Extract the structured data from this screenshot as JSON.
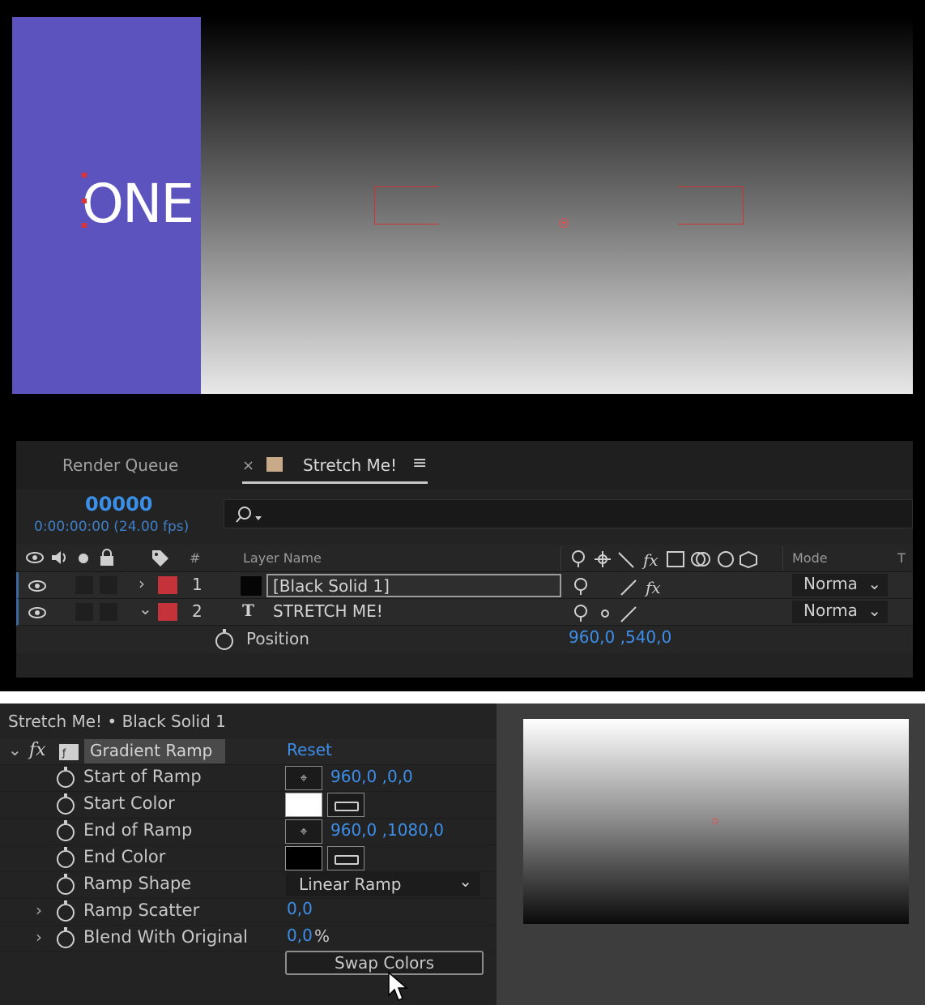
{
  "viewer": {
    "brand_text": "ONE",
    "accent_color": "#5c53bf",
    "gradient": [
      "#000000",
      "#e8e8e8"
    ]
  },
  "timeline": {
    "tabs": [
      {
        "label": "Render Queue",
        "active": false
      },
      {
        "label": "Stretch Me!",
        "active": true
      }
    ],
    "close_glyph": "×",
    "menu_glyph": "≡",
    "timecode": "00000",
    "timecode_sub": "0:00:00:00 (24.00 fps)",
    "search_icon": "search-icon",
    "columns": {
      "hash": "#",
      "layer_name": "Layer Name",
      "mode": "Mode",
      "t": "T"
    },
    "layers": [
      {
        "num": "1",
        "type_glyph": "",
        "name": "[Black Solid 1]",
        "mode": "Norma",
        "expanded": false,
        "label_color": "#c4323a"
      },
      {
        "num": "2",
        "type_glyph": "T",
        "name": "STRETCH ME!",
        "mode": "Norma",
        "expanded": true,
        "label_color": "#c4323a"
      }
    ],
    "property": {
      "name": "Position",
      "value": "960,0 ,540,0"
    }
  },
  "effects": {
    "panel_title": "Stretch Me! • Black Solid 1",
    "effect_name": "Gradient Ramp",
    "reset_label": "Reset",
    "props": [
      {
        "label": "Start of Ramp",
        "value": "960,0 ,0,0"
      },
      {
        "label": "Start Color",
        "swatch": "#ffffff"
      },
      {
        "label": "End of Ramp",
        "value": "960,0 ,1080,0"
      },
      {
        "label": "End Color",
        "swatch": "#000000"
      },
      {
        "label": "Ramp Shape",
        "dropdown": "Linear Ramp"
      },
      {
        "label": "Ramp Scatter",
        "value": "0,0"
      },
      {
        "label": "Blend With Original",
        "value": "0,0",
        "unit": "%"
      }
    ],
    "swap_label": "Swap Colors"
  }
}
